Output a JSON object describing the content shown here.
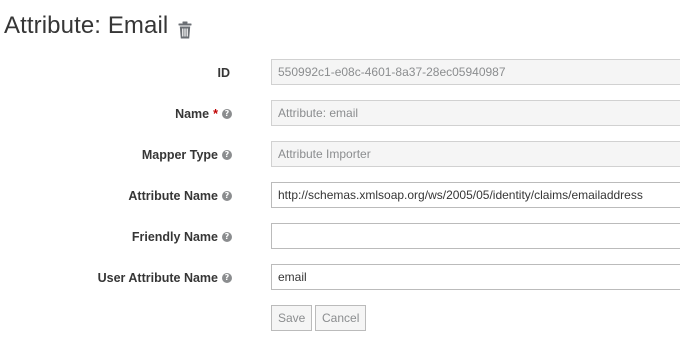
{
  "header": {
    "title": "Attribute: Email",
    "delete_icon": "trash-icon"
  },
  "form": {
    "id": {
      "label": "ID",
      "value": "550992c1-e08c-4601-8a37-28ec05940987"
    },
    "name": {
      "label": "Name",
      "required_marker": "*",
      "help_icon": "question-circle-icon",
      "value": "Attribute: email"
    },
    "mapper_type": {
      "label": "Mapper Type",
      "help_icon": "question-circle-icon",
      "value": "Attribute Importer"
    },
    "attribute_name": {
      "label": "Attribute Name",
      "help_icon": "question-circle-icon",
      "value": "http://schemas.xmlsoap.org/ws/2005/05/identity/claims/emailaddress"
    },
    "friendly_name": {
      "label": "Friendly Name",
      "help_icon": "question-circle-icon",
      "value": ""
    },
    "user_attribute_name": {
      "label": "User Attribute Name",
      "help_icon": "question-circle-icon",
      "value": "email"
    }
  },
  "actions": {
    "save_label": "Save",
    "cancel_label": "Cancel"
  },
  "colors": {
    "required": "#c00000",
    "readonly_bg": "#f5f5f5",
    "border": "#bbbbbb"
  }
}
